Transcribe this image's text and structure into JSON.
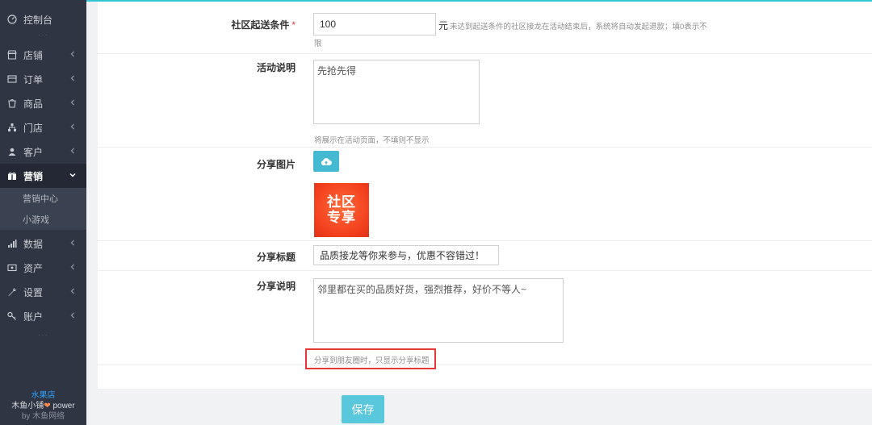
{
  "sidebar": {
    "dashboard": "控制台",
    "items": [
      {
        "label": "店铺",
        "icon": "store-icon"
      },
      {
        "label": "订单",
        "icon": "order-icon"
      },
      {
        "label": "商品",
        "icon": "goods-icon"
      },
      {
        "label": "门店",
        "icon": "shop-icon"
      },
      {
        "label": "客户",
        "icon": "customer-icon"
      }
    ],
    "active": {
      "label": "营销",
      "icon": "marketing-icon"
    },
    "sub_items": [
      "营销中心",
      "小游戏"
    ],
    "items_after": [
      {
        "label": "数据",
        "icon": "data-icon"
      },
      {
        "label": "资产",
        "icon": "assets-icon"
      },
      {
        "label": "设置",
        "icon": "settings-icon"
      },
      {
        "label": "账户",
        "icon": "account-icon"
      }
    ],
    "dots": "···",
    "footer": {
      "store": "水果店",
      "brand_prefix": "木鱼小铺",
      "brand_suffix": " power",
      "by": "by 木鱼网络"
    }
  },
  "form": {
    "threshold": {
      "label": "社区起送条件",
      "required_mark": "*",
      "value": "100",
      "unit": "元",
      "help_line1": "未达到起送条件的社区接龙在活动结束后，系统将自动发起退款；填0表示不",
      "help_line2": "限"
    },
    "description": {
      "label": "活动说明",
      "value": "先抢先得",
      "help": "将展示在活动页面，不填则不显示"
    },
    "share_image": {
      "label": "分享图片",
      "image_line1": "社区",
      "image_line2": "专享"
    },
    "share_title": {
      "label": "分享标题",
      "value": "品质接龙等你来参与，优惠不容错过！"
    },
    "share_desc": {
      "label": "分享说明",
      "value": "邻里都在买的品质好货，强烈推荐，好价不等人~",
      "help": "分享到朋友圈时，只显示分享标题"
    }
  },
  "actions": {
    "save_label": "保存"
  },
  "colors": {
    "accent": "#33c6d4",
    "save_button": "#5ac8dc",
    "upload_button": "#43b9d2",
    "highlight_box": "#e53935",
    "sidebar_bg": "#2f3542"
  }
}
